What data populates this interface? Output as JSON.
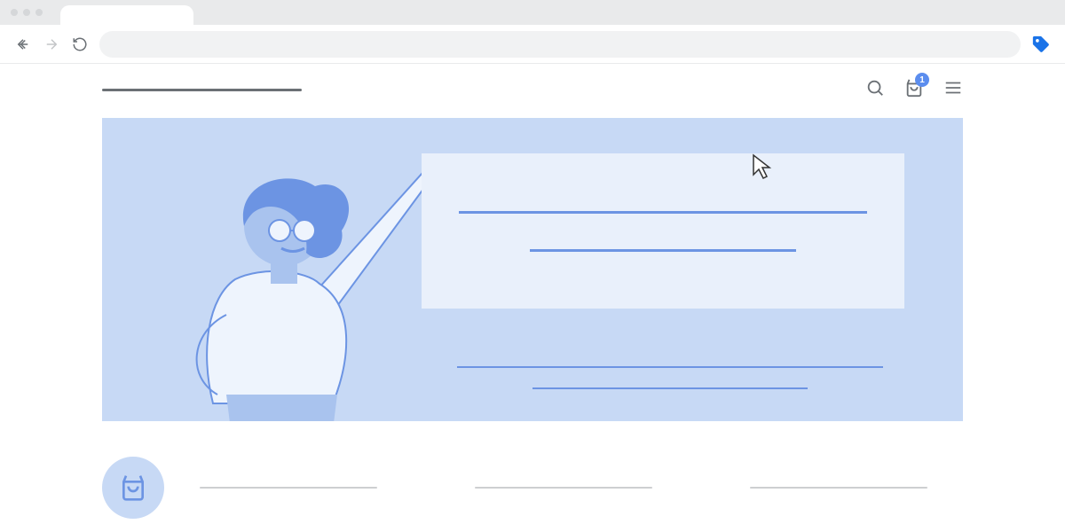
{
  "header": {
    "cart_badge": "1"
  },
  "icons": {
    "back": "back-icon",
    "forward": "forward-icon",
    "refresh": "refresh-icon",
    "search": "search-icon",
    "bag": "shopping-bag-icon",
    "menu": "hamburger-icon",
    "tag": "price-tag-icon"
  },
  "colors": {
    "hero_bg": "#C7D9F5",
    "hero_card_bg": "#E9F0FB",
    "accent_line": "#6C94E3",
    "badge": "#5B8DEE"
  }
}
